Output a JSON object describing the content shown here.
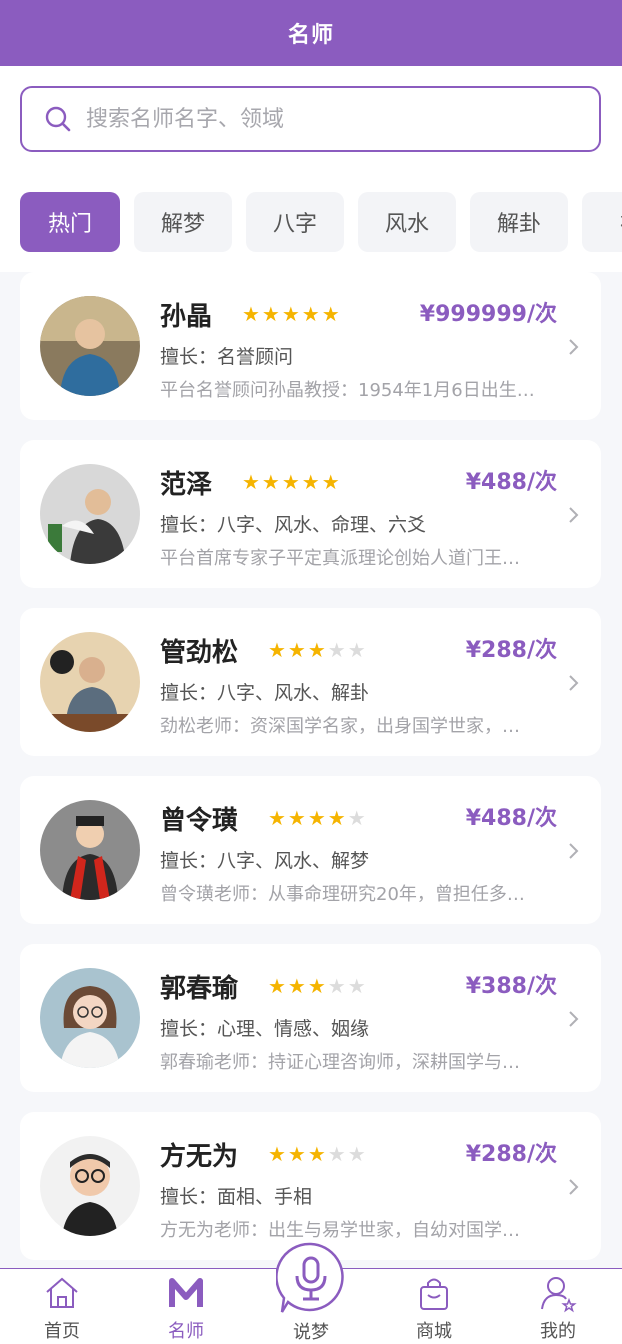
{
  "header": {
    "title": "名师"
  },
  "search": {
    "placeholder": "搜索名师名字、领域"
  },
  "tabs": [
    {
      "label": "热门",
      "active": true
    },
    {
      "label": "解梦",
      "active": false
    },
    {
      "label": "八字",
      "active": false
    },
    {
      "label": "风水",
      "active": false
    },
    {
      "label": "解卦",
      "active": false
    },
    {
      "label": "初",
      "active": false
    }
  ],
  "teachers": [
    {
      "name": "孙晶",
      "rating": 5,
      "price": "¥999999/次",
      "skill": "擅长：名誉顾问",
      "desc": "平台名誉顾问孙晶教授：1954年1月6日出生…"
    },
    {
      "name": "范泽",
      "rating": 5,
      "price": "¥488/次",
      "skill": "擅长：八字、风水、命理、六爻",
      "desc": "平台首席专家子平定真派理论创始人道门王…"
    },
    {
      "name": "管劲松",
      "rating": 3,
      "price": "¥288/次",
      "skill": "擅长：八字、风水、解卦",
      "desc": "劲松老师：资深国学名家，出身国学世家，…"
    },
    {
      "name": "曾令璜",
      "rating": 4,
      "price": "¥488/次",
      "skill": "擅长：八字、风水、解梦",
      "desc": "曾令璜老师：从事命理研究20年，曾担任多…"
    },
    {
      "name": "郭春瑜",
      "rating": 3,
      "price": "¥388/次",
      "skill": "擅长：心理、情感、姻缘",
      "desc": "郭春瑜老师：持证心理咨询师，深耕国学与…"
    },
    {
      "name": "方无为",
      "rating": 3,
      "price": "¥288/次",
      "skill": "擅长：面相、手相",
      "desc": "方无为老师：出生与易学世家，自幼对国学…"
    }
  ],
  "bottom_nav": [
    {
      "label": "首页",
      "icon": "home-icon",
      "active": false
    },
    {
      "label": "名师",
      "icon": "m-logo-icon",
      "active": true
    },
    {
      "label": "说梦",
      "icon": "microphone-icon",
      "active": false
    },
    {
      "label": "商城",
      "icon": "shopping-bag-icon",
      "active": false
    },
    {
      "label": "我的",
      "icon": "user-star-icon",
      "active": false
    }
  ],
  "colors": {
    "brand": "#8b5cbf",
    "star": "#f5b400",
    "star_off": "#dcdcdc"
  }
}
